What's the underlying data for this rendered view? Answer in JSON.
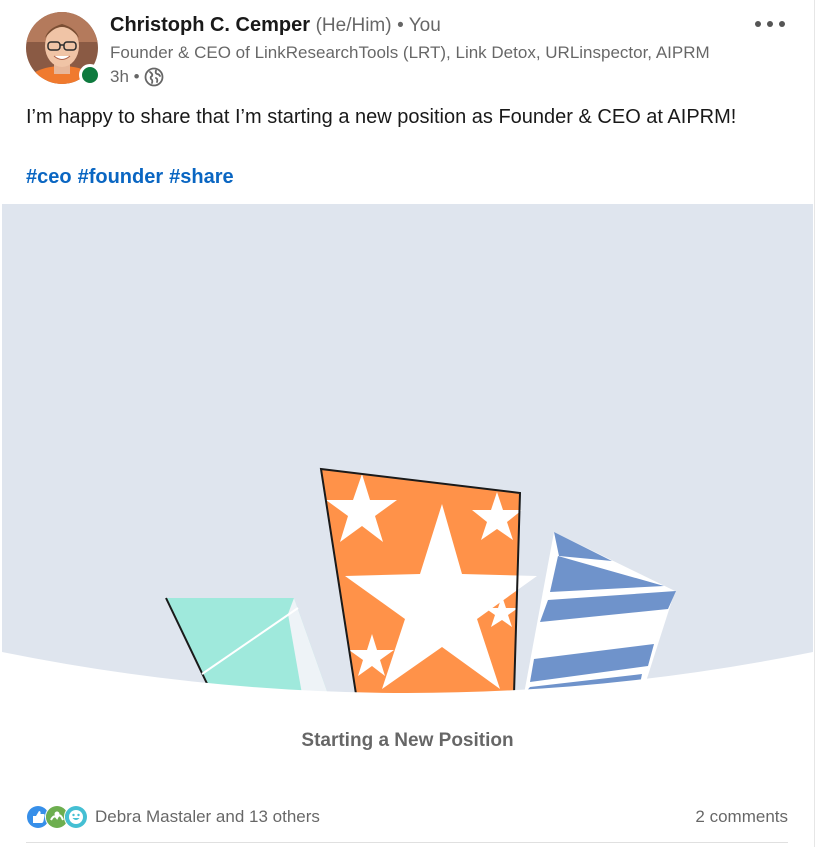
{
  "author": {
    "name": "Christoph C. Cemper",
    "pronouns": "(He/Him)",
    "connection": "• You",
    "headline": "Founder & CEO of LinkResearchTools (LRT), Link Detox, URLinspector, AIPRM",
    "time": "3h •",
    "visibility_icon": "globe-icon",
    "online_color": "#0e7a3e"
  },
  "post": {
    "commentary": "I’m happy to share that I’m starting a new position as Founder & CEO at AIPRM!",
    "hashtags": [
      "#ceo",
      "#founder",
      "#share"
    ],
    "media_caption": "Starting a New Position"
  },
  "social": {
    "reactions_text": "Debra Mastaler and 13 others",
    "comments_text": "2 comments",
    "reaction_icons": [
      "like-icon",
      "support-icon",
      "funny-icon"
    ]
  },
  "colors": {
    "hashtag": "#0a66c2",
    "media_background": "#dfe5ee",
    "orange_box": "#ff9249",
    "teal_box": "#9fe9dc",
    "blue_box": "#6f93cb"
  }
}
